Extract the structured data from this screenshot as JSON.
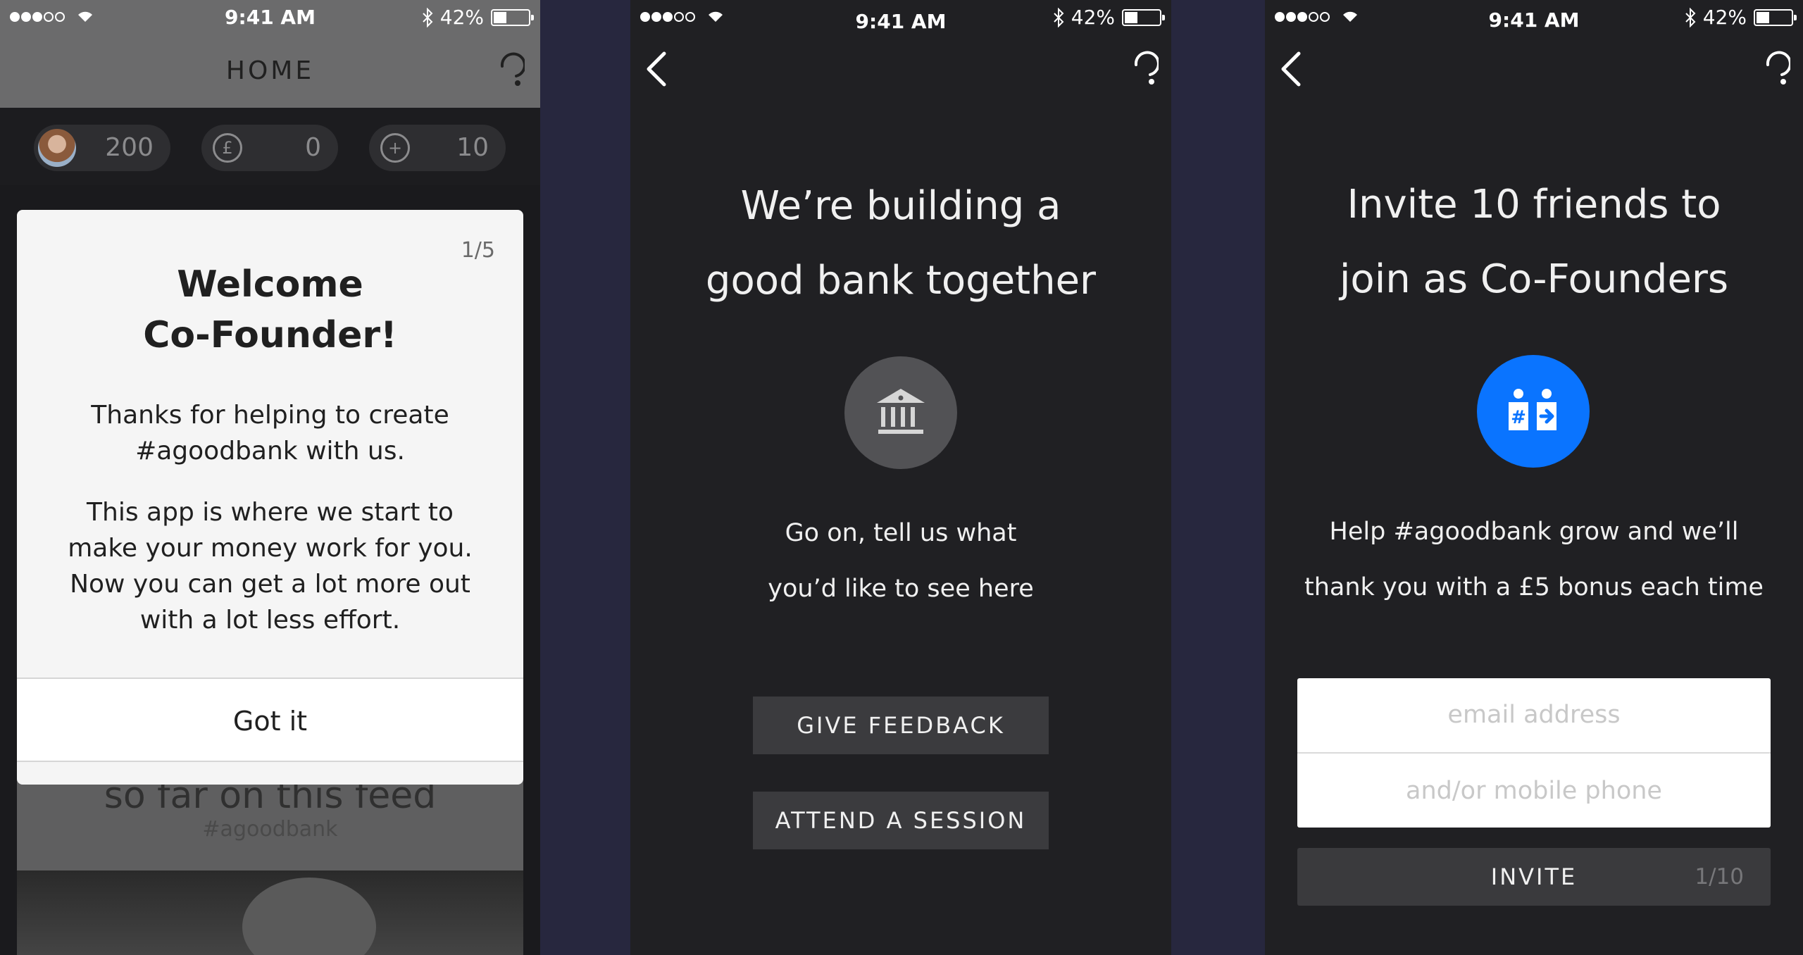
{
  "status_bar": {
    "time": "9:41 AM",
    "battery": "42%",
    "battery_level": 0.42
  },
  "screen1": {
    "header_title": "HOME",
    "stats": [
      {
        "icon": "avatar",
        "value": "200"
      },
      {
        "icon": "pound-icon",
        "value": "0"
      },
      {
        "icon": "plus-circle-icon",
        "value": "10"
      }
    ],
    "pound_glyph": "£",
    "plus_glyph": "+",
    "background_fragment": "so far on this feed",
    "background_hashtag": "#agoodbank",
    "modal": {
      "counter": "1/5",
      "title_line1": "Welcome",
      "title_line2": "Co-Founder!",
      "para1_line1": "Thanks for helping to create",
      "para1_line2": "#agoodbank with us.",
      "para2_line1": "This app is where we start to",
      "para2_line2": "make your money work for you.",
      "para2_line3": "Now you can get a lot more out",
      "para2_line4": "with a lot less effort.",
      "button": "Got it"
    }
  },
  "screen2": {
    "title_line1": "We’re building a",
    "title_line2": "good bank together",
    "icon": "bank-icon",
    "subtitle_line1": "Go on, tell us what",
    "subtitle_line2": "you’d like to see here",
    "button1": "GIVE FEEDBACK",
    "button2": "ATTEND A SESSION"
  },
  "screen3": {
    "title_line1": "Invite 10 friends to",
    "title_line2": "join as Co-Founders",
    "icon": "invite-friends-icon",
    "icon_color": "#0a74ff",
    "subtitle_line1": "Help #agoodbank grow and we’ll",
    "subtitle_line2": "thank you with a £5 bonus each time",
    "email_placeholder": "email address",
    "phone_placeholder": "and/or mobile phone",
    "invite_label": "INVITE",
    "invite_count": "1/10"
  }
}
